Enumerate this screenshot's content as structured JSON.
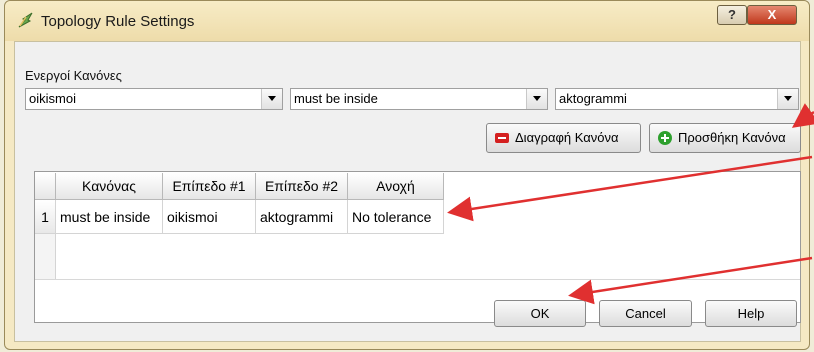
{
  "window": {
    "title": "Topology Rule Settings",
    "help_button": "?",
    "close_button": "X"
  },
  "rules_section": {
    "label": "Ενεργοί Κανόνες",
    "layer1_value": "oikismoi",
    "rule_value": "must be inside",
    "layer2_value": "aktogrammi"
  },
  "actions": {
    "delete_rule": "Διαγραφή Κανόνα",
    "add_rule": "Προσθήκη Κανόνα"
  },
  "table": {
    "columns": [
      "Κανόνας",
      "Επίπεδο #1",
      "Επίπεδο #2",
      "Ανοχή"
    ],
    "rows": [
      {
        "index": "1",
        "rule": "must be inside",
        "layer1": "oikismoi",
        "layer2": "aktogrammi",
        "tolerance": "No tolerance"
      }
    ]
  },
  "buttons": {
    "ok": "OK",
    "cancel": "Cancel",
    "help": "Help"
  },
  "colors": {
    "title_bar": "#f5e9c4",
    "close_button": "#c8482c",
    "annotation_arrow": "#e03030",
    "delete_icon": "#d42020",
    "add_icon": "#2ea02e"
  }
}
